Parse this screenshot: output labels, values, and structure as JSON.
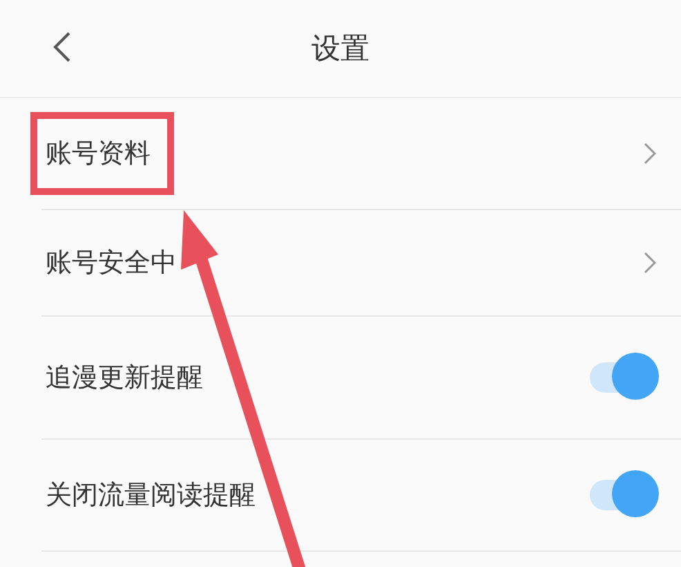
{
  "header": {
    "title": "设置"
  },
  "rows": [
    {
      "kind": "link",
      "label": "账号资料",
      "highlighted": true
    },
    {
      "kind": "link",
      "label": "账号安全中",
      "highlighted": false
    },
    {
      "kind": "toggle",
      "label": "追漫更新提醒",
      "on": true,
      "highlighted": false
    },
    {
      "kind": "toggle",
      "label": "关闭流量阅读提醒",
      "on": true,
      "highlighted": false
    }
  ]
}
